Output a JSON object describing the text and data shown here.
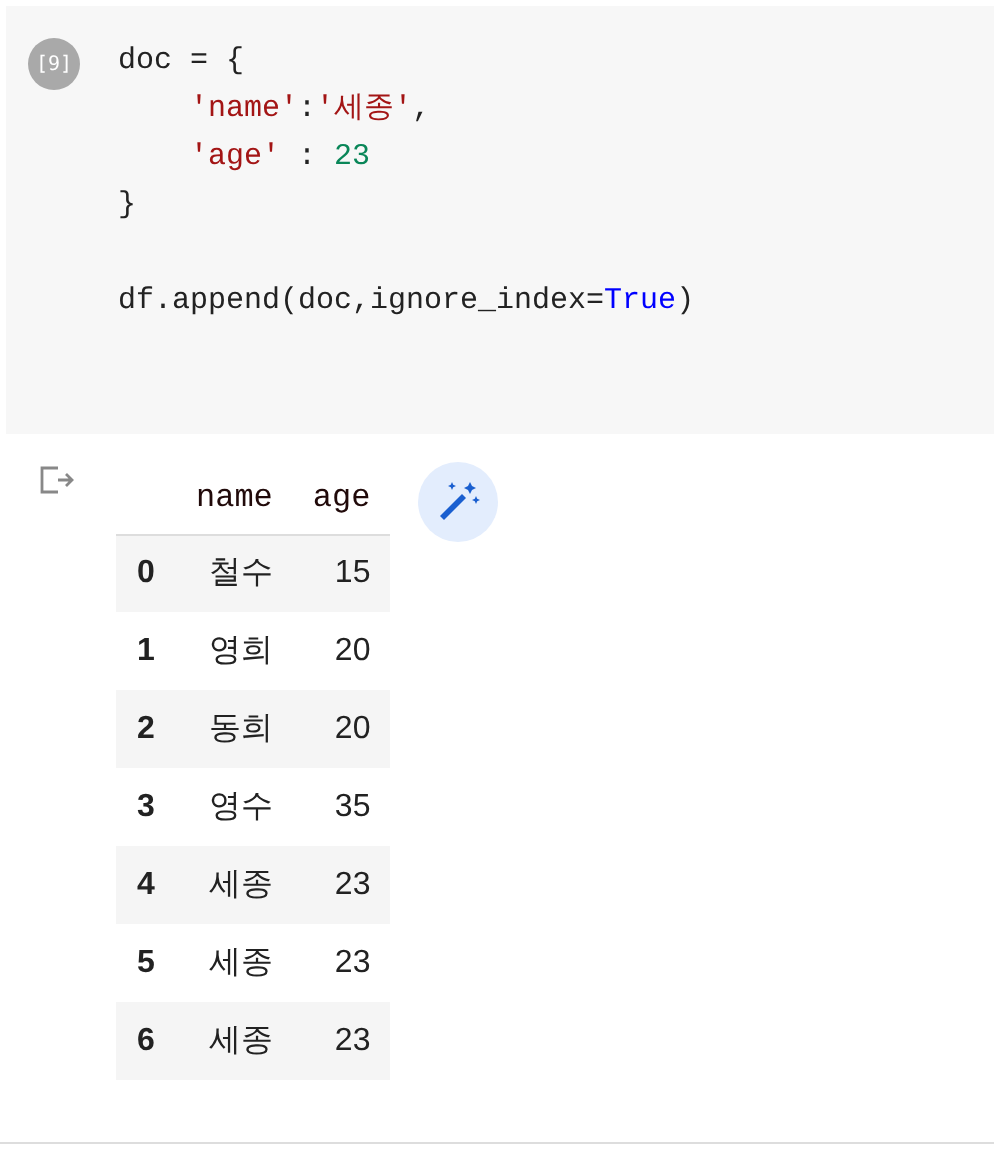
{
  "cell": {
    "execution_count": "[9]",
    "code": [
      {
        "kind": "plain",
        "text": "doc = {\n    "
      },
      {
        "kind": "string",
        "text": "'name'"
      },
      {
        "kind": "plain",
        "text": ":"
      },
      {
        "kind": "string",
        "text": "'세종'"
      },
      {
        "kind": "plain",
        "text": ",\n    "
      },
      {
        "kind": "string",
        "text": "'age'"
      },
      {
        "kind": "plain",
        "text": " : "
      },
      {
        "kind": "number",
        "text": "23"
      },
      {
        "kind": "plain",
        "text": "\n}\n\ndf.append(doc,ignore_index="
      },
      {
        "kind": "keyword",
        "text": "True"
      },
      {
        "kind": "plain",
        "text": ")"
      }
    ]
  },
  "output": {
    "table": {
      "columns": [
        "",
        "name",
        "age"
      ],
      "rows": [
        [
          "0",
          "철수",
          "15"
        ],
        [
          "1",
          "영희",
          "20"
        ],
        [
          "2",
          "동희",
          "20"
        ],
        [
          "3",
          "영수",
          "35"
        ],
        [
          "4",
          "세종",
          "23"
        ],
        [
          "5",
          "세종",
          "23"
        ],
        [
          "6",
          "세종",
          "23"
        ]
      ]
    }
  }
}
